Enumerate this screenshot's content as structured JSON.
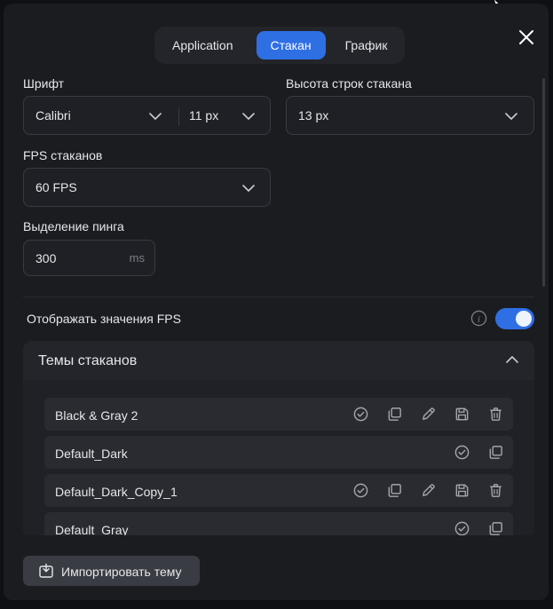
{
  "tabs": {
    "application": "Application",
    "glass": "Стакан",
    "chart": "График",
    "active": "glass"
  },
  "font": {
    "label": "Шрифт",
    "family": "Calibri",
    "size": "11 px"
  },
  "row_height": {
    "label": "Высота строк стакана",
    "value": "13 px"
  },
  "fps": {
    "label": "FPS стаканов",
    "value": "60 FPS"
  },
  "ping": {
    "label": "Выделение пинга",
    "value": "300",
    "unit": "ms"
  },
  "show_fps": {
    "label": "Отображать значения FPS",
    "enabled": true
  },
  "themes": {
    "title": "Темы стаканов",
    "expanded": true,
    "items": [
      {
        "name": "Black & Gray 2"
      },
      {
        "name": "Default_Dark"
      },
      {
        "name": "Default_Dark_Copy_1"
      },
      {
        "name": "Default_Gray"
      }
    ]
  },
  "import_button": {
    "label": "Импортировать тему"
  },
  "colors": {
    "accent": "#2f6fe4",
    "panel": "#1b1c20",
    "field_border": "#3a3b42"
  }
}
